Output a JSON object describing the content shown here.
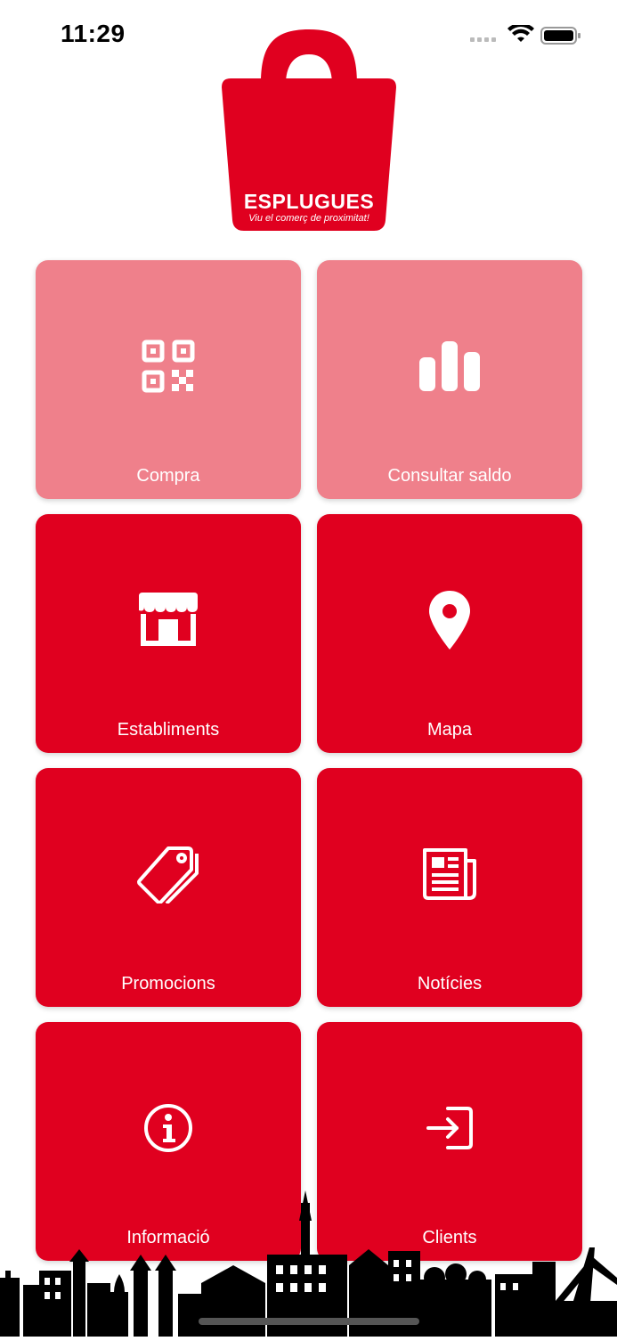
{
  "status_bar": {
    "time": "11:29"
  },
  "logo": {
    "title": "ESPLUGUES",
    "tagline": "Viu el comerç de proximitat!"
  },
  "tiles": [
    {
      "label": "Compra",
      "icon": "qr-code-icon",
      "color": "#ef808b"
    },
    {
      "label": "Consultar saldo",
      "icon": "bar-chart-icon",
      "color": "#ef808b"
    },
    {
      "label": "Establiments",
      "icon": "store-icon",
      "color": "#e0001f"
    },
    {
      "label": "Mapa",
      "icon": "map-pin-icon",
      "color": "#e0001f"
    },
    {
      "label": "Promocions",
      "icon": "tags-icon",
      "color": "#e0001f"
    },
    {
      "label": "Notícies",
      "icon": "newspaper-icon",
      "color": "#e0001f"
    },
    {
      "label": "Informació",
      "icon": "info-icon",
      "color": "#e0001f"
    },
    {
      "label": "Clients",
      "icon": "login-icon",
      "color": "#e0001f"
    }
  ],
  "colors": {
    "brand_red": "#e0001f",
    "light_red": "#ef808b"
  }
}
